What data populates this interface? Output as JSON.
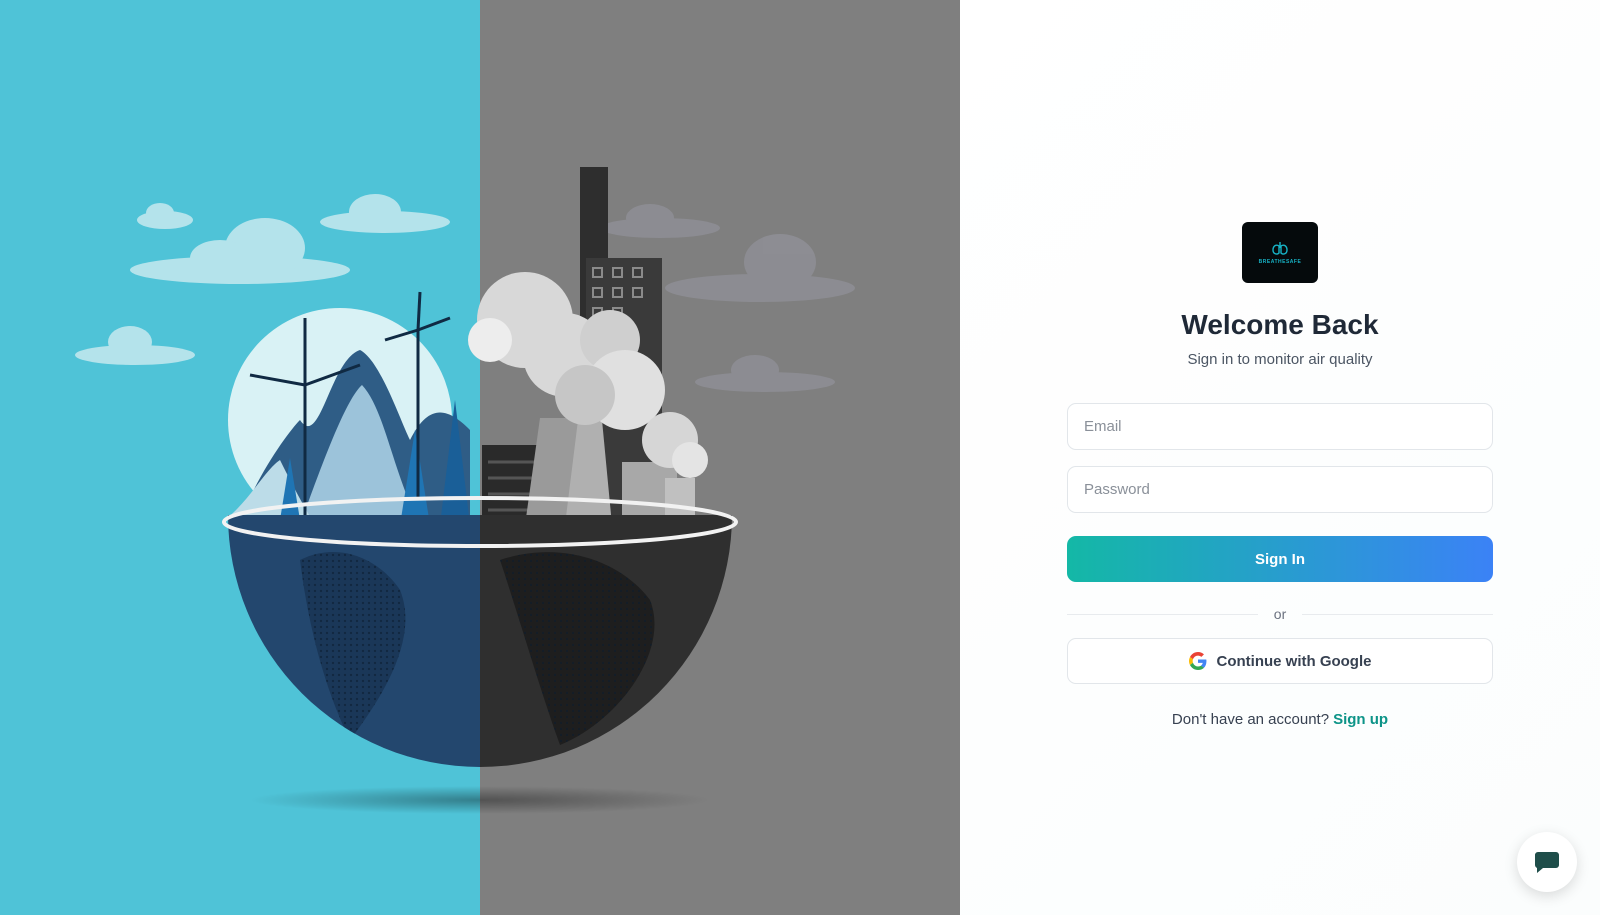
{
  "app": {
    "logo_text": "BREATHESAFE"
  },
  "login": {
    "title": "Welcome Back",
    "subtitle": "Sign in to monitor air quality",
    "email_placeholder": "Email",
    "password_placeholder": "Password",
    "signin_label": "Sign In",
    "divider_label": "or",
    "google_label": "Continue with Google",
    "signup_prompt": "Don't have an account?",
    "signup_link": "Sign up"
  },
  "icons": {
    "logo": "lungs-logo-icon",
    "google": "google-icon",
    "chat": "chat-bubble-icon"
  },
  "colors": {
    "clean_side": "#4fc3d7",
    "polluted_side": "#7f7f7f",
    "accent_start": "#14b8a6",
    "accent_end": "#3b82f6",
    "link": "#0d9488",
    "logo_bg": "#050a0c"
  }
}
